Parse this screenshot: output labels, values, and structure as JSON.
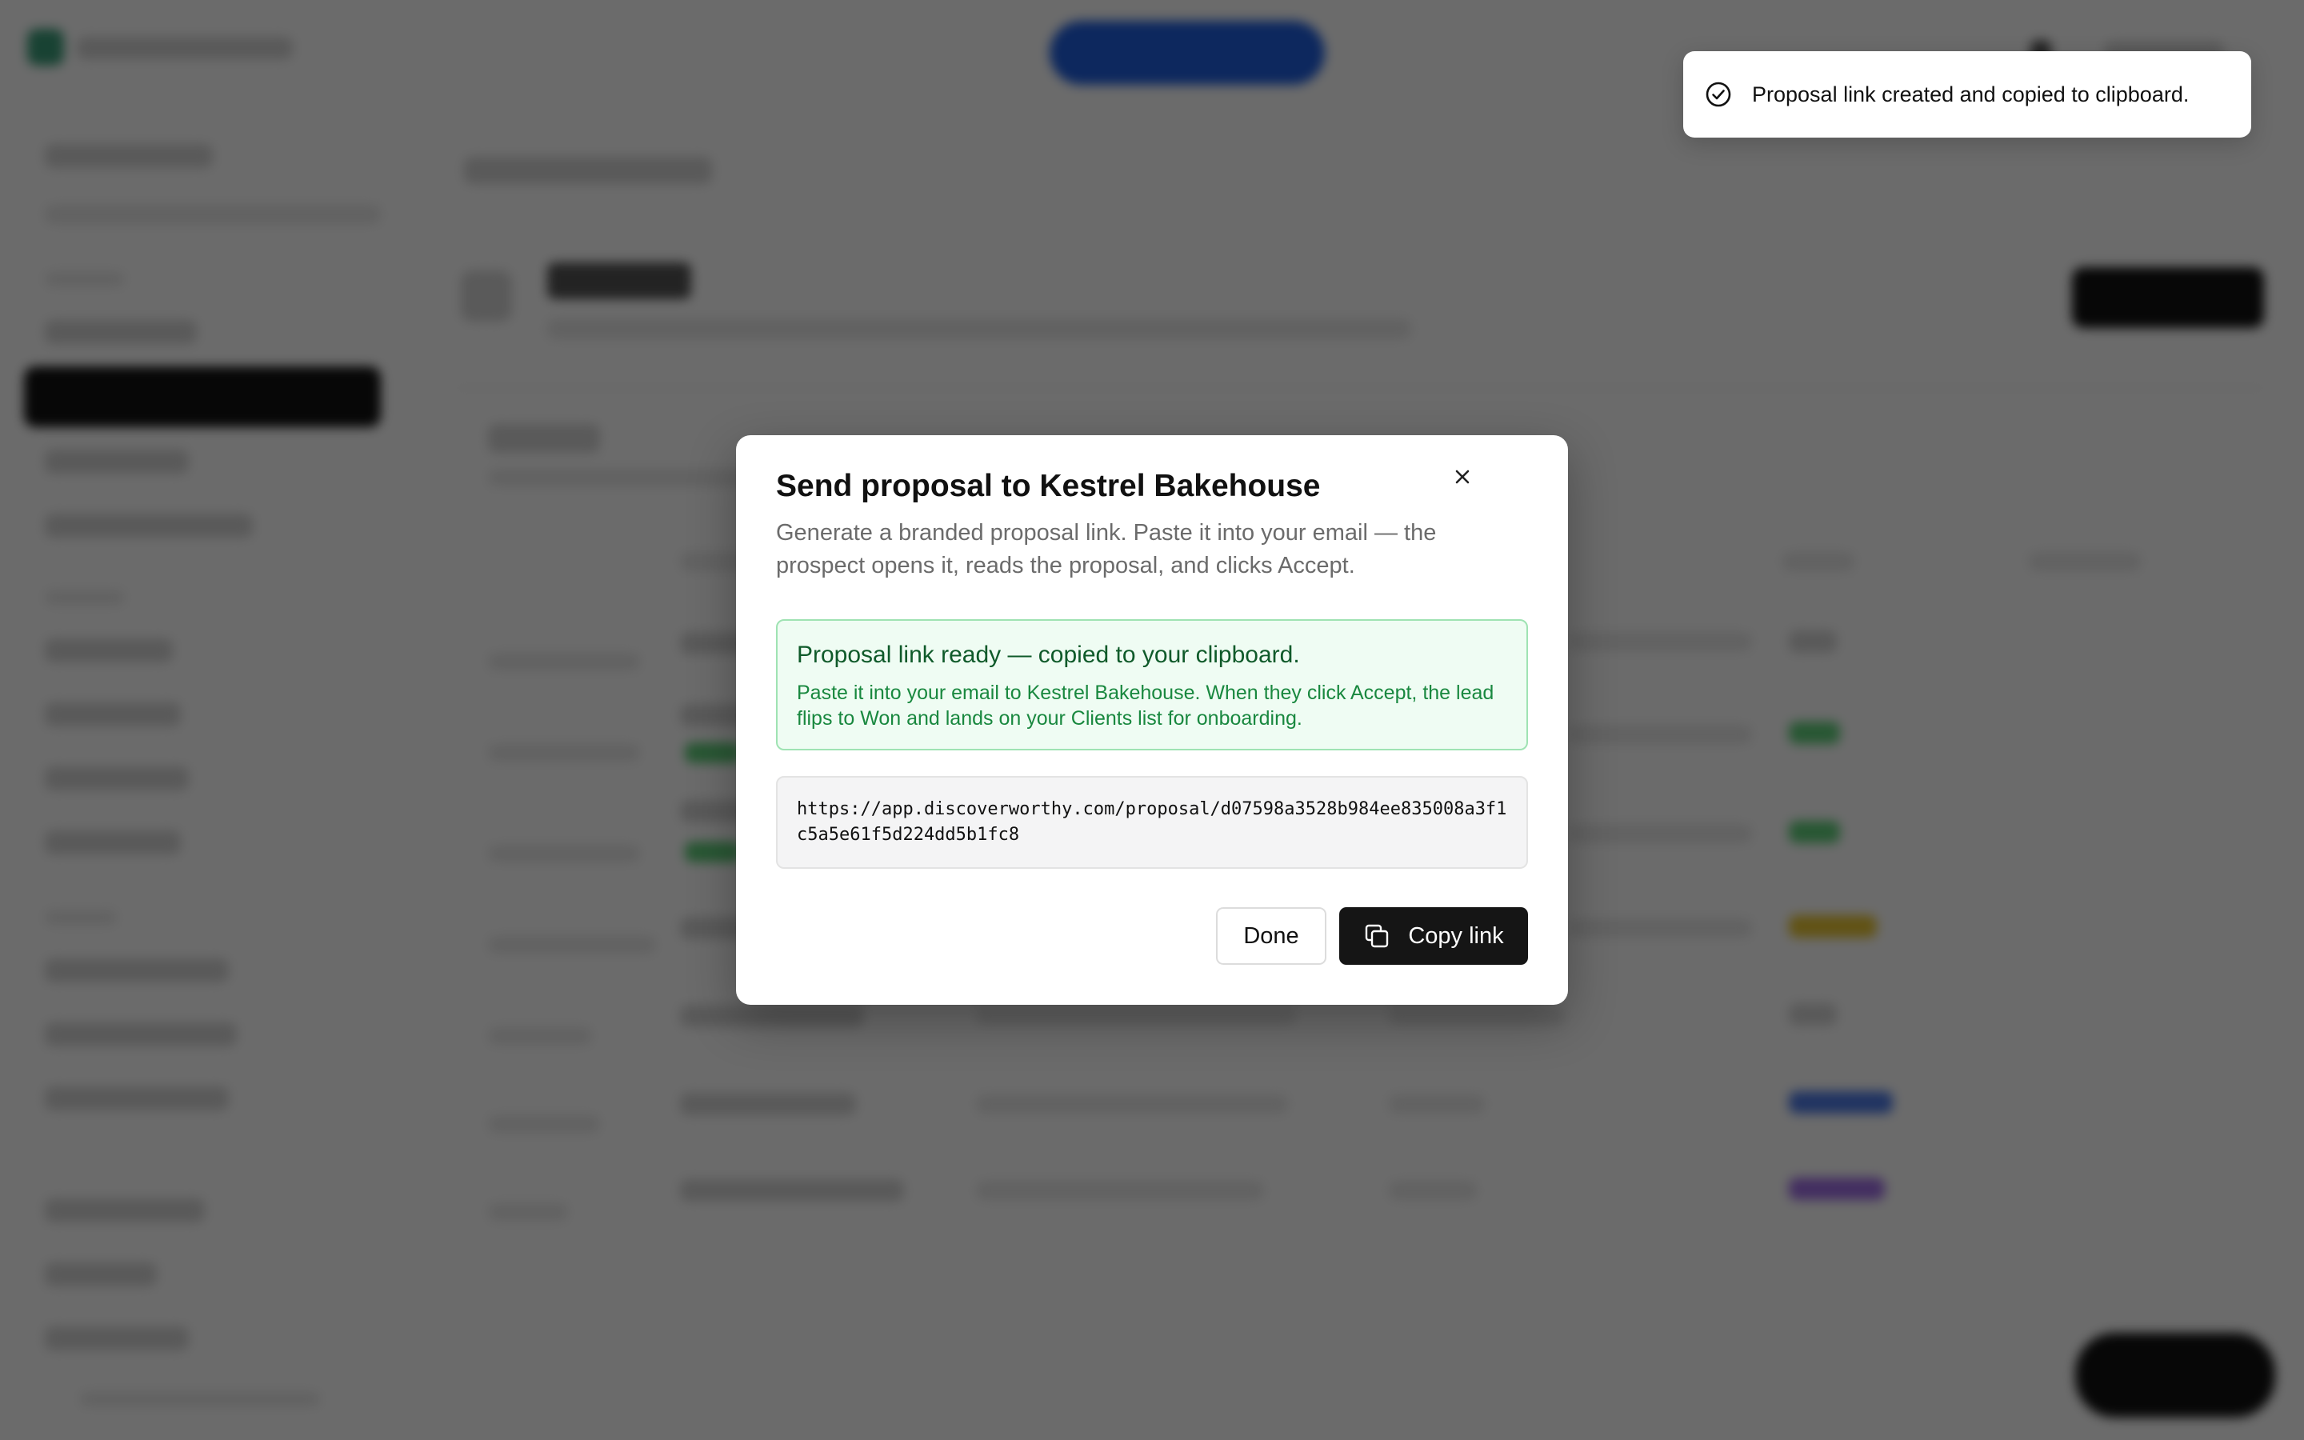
{
  "toast": {
    "icon": "check-circle-icon",
    "message": "Proposal link created and copied to clipboard."
  },
  "modal": {
    "title": "Send proposal to Kestrel Bakehouse",
    "description": "Generate a branded proposal link. Paste it into your email — the prospect opens it, reads the proposal, and clicks Accept.",
    "close_icon": "close-icon",
    "success": {
      "title": "Proposal link ready — copied to your clipboard.",
      "body": "Paste it into your email to Kestrel Bakehouse. When they click Accept, the lead flips to Won and lands on your Clients list for onboarding."
    },
    "link": "https://app.discoverworthy.com/proposal/d07598a3528b984ee835008a3f1c5a5e61f5d224dd5b1fc8",
    "done_label": "Done",
    "copy_label": "Copy link",
    "copy_icon": "copy-icon"
  },
  "colors": {
    "primary_button": "#151515",
    "success_bg": "#effcf3",
    "success_border": "#9fe3b3",
    "success_text": "#19883f",
    "overlay": "rgba(0,0,0,0.58)"
  }
}
